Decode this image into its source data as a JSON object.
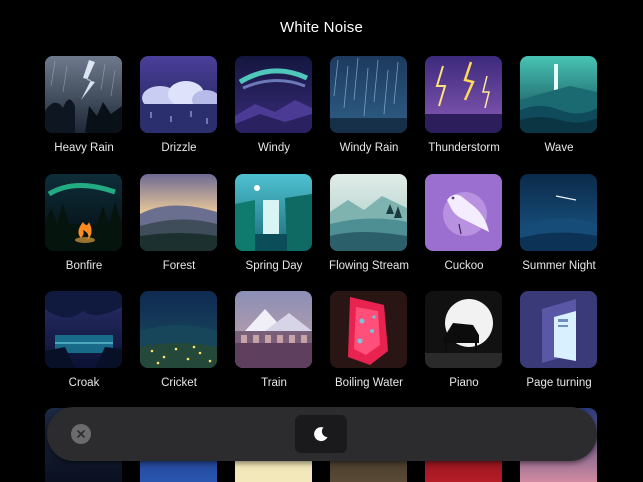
{
  "page": {
    "title": "White Noise"
  },
  "sounds": [
    {
      "label": "Heavy Rain",
      "icon": "heavy-rain-icon",
      "selected": true
    },
    {
      "label": "Drizzle",
      "icon": "drizzle-icon"
    },
    {
      "label": "Windy",
      "icon": "windy-icon"
    },
    {
      "label": "Windy Rain",
      "icon": "windy-rain-icon"
    },
    {
      "label": "Thunderstorm",
      "icon": "thunderstorm-icon"
    },
    {
      "label": "Wave",
      "icon": "wave-icon"
    },
    {
      "label": "Bonfire",
      "icon": "bonfire-icon"
    },
    {
      "label": "Forest",
      "icon": "forest-icon"
    },
    {
      "label": "Spring Day",
      "icon": "spring-day-icon"
    },
    {
      "label": "Flowing Stream",
      "icon": "flowing-stream-icon"
    },
    {
      "label": "Cuckoo",
      "icon": "cuckoo-icon"
    },
    {
      "label": "Summer Night",
      "icon": "summer-night-icon"
    },
    {
      "label": "Croak",
      "icon": "croak-icon"
    },
    {
      "label": "Cricket",
      "icon": "cricket-icon"
    },
    {
      "label": "Train",
      "icon": "train-icon"
    },
    {
      "label": "Boiling Water",
      "icon": "boiling-water-icon"
    },
    {
      "label": "Piano",
      "icon": "piano-icon"
    },
    {
      "label": "Page turning",
      "icon": "page-turning-icon"
    }
  ],
  "player_bar": {
    "close_icon": "close-icon",
    "timer_icon": "moon-icon"
  }
}
